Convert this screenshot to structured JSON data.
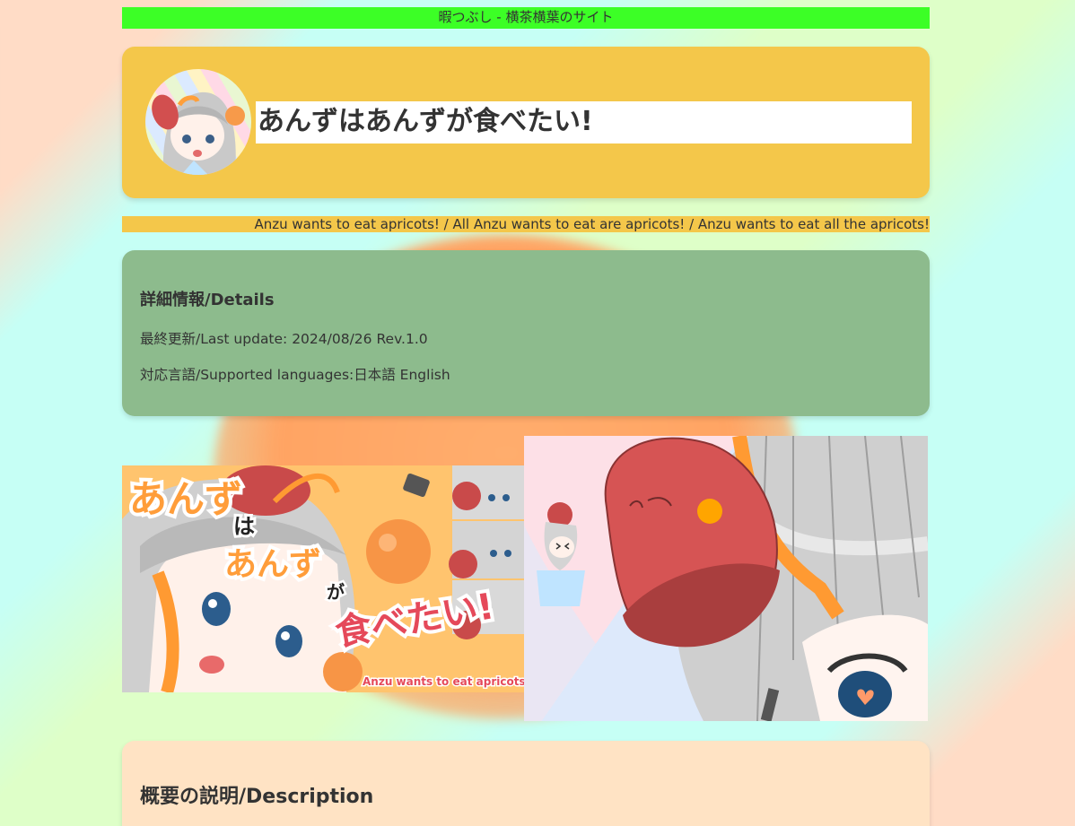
{
  "site_bar": {
    "text": "暇つぶし - 横茶横葉のサイト"
  },
  "header": {
    "title": "あんずはあんずが食べたい!",
    "subtitle": "Anzu wants to eat apricots! / All Anzu wants to eat are apricots! / Anzu wants to eat all the apricots!"
  },
  "details": {
    "heading": "詳細情報/Details",
    "last_update": "最終更新/Last update: 2024/08/26 Rev.1.0",
    "languages": "対応言語/Supported languages:日本語 English"
  },
  "key_art": {
    "title_lines": [
      "あんず",
      "は",
      "あんず",
      "が",
      "食べたい!"
    ],
    "caption": "Anzu wants to eat apricots!"
  },
  "description": {
    "heading": "概要の説明/Description"
  },
  "colors": {
    "site_bar": "#3cff26",
    "header_bg": "#f4c74a",
    "details_bg": "#8dbb8d",
    "description_bg": "#ffe3c4",
    "text": "#333333",
    "apricot": "#ffa463"
  }
}
